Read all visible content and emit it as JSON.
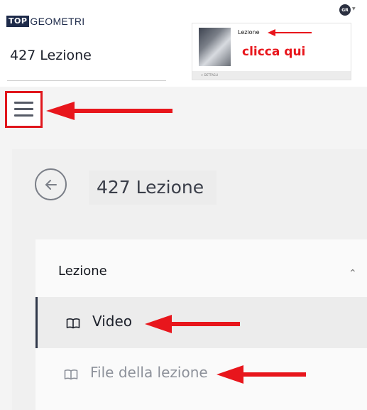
{
  "header": {
    "logo": {
      "box_text": "TOP",
      "rest_text": "GEOMETRI"
    },
    "course_title": "427 Lezione",
    "avatar_initials": "GR"
  },
  "lesson_card": {
    "title": "Lezione",
    "footer": "> DETTAGLI",
    "annotation": "clicca qui"
  },
  "main": {
    "page_title": "427 Lezione",
    "section": {
      "title": "Lezione",
      "items": [
        {
          "label": "Video",
          "icon": "book-icon",
          "active": true
        },
        {
          "label": "File della lezione",
          "icon": "book-icon",
          "active": false
        }
      ]
    }
  },
  "icons": {
    "back": "arrow-left-icon",
    "menu": "hamburger-menu-icon",
    "collapse": "chevron-up-icon",
    "avatar_dropdown": "chevron-down-icon"
  },
  "colors": {
    "annotation_red": "#e8161c",
    "brand_navy": "#1e2b4a",
    "active_indicator": "#30384a"
  }
}
